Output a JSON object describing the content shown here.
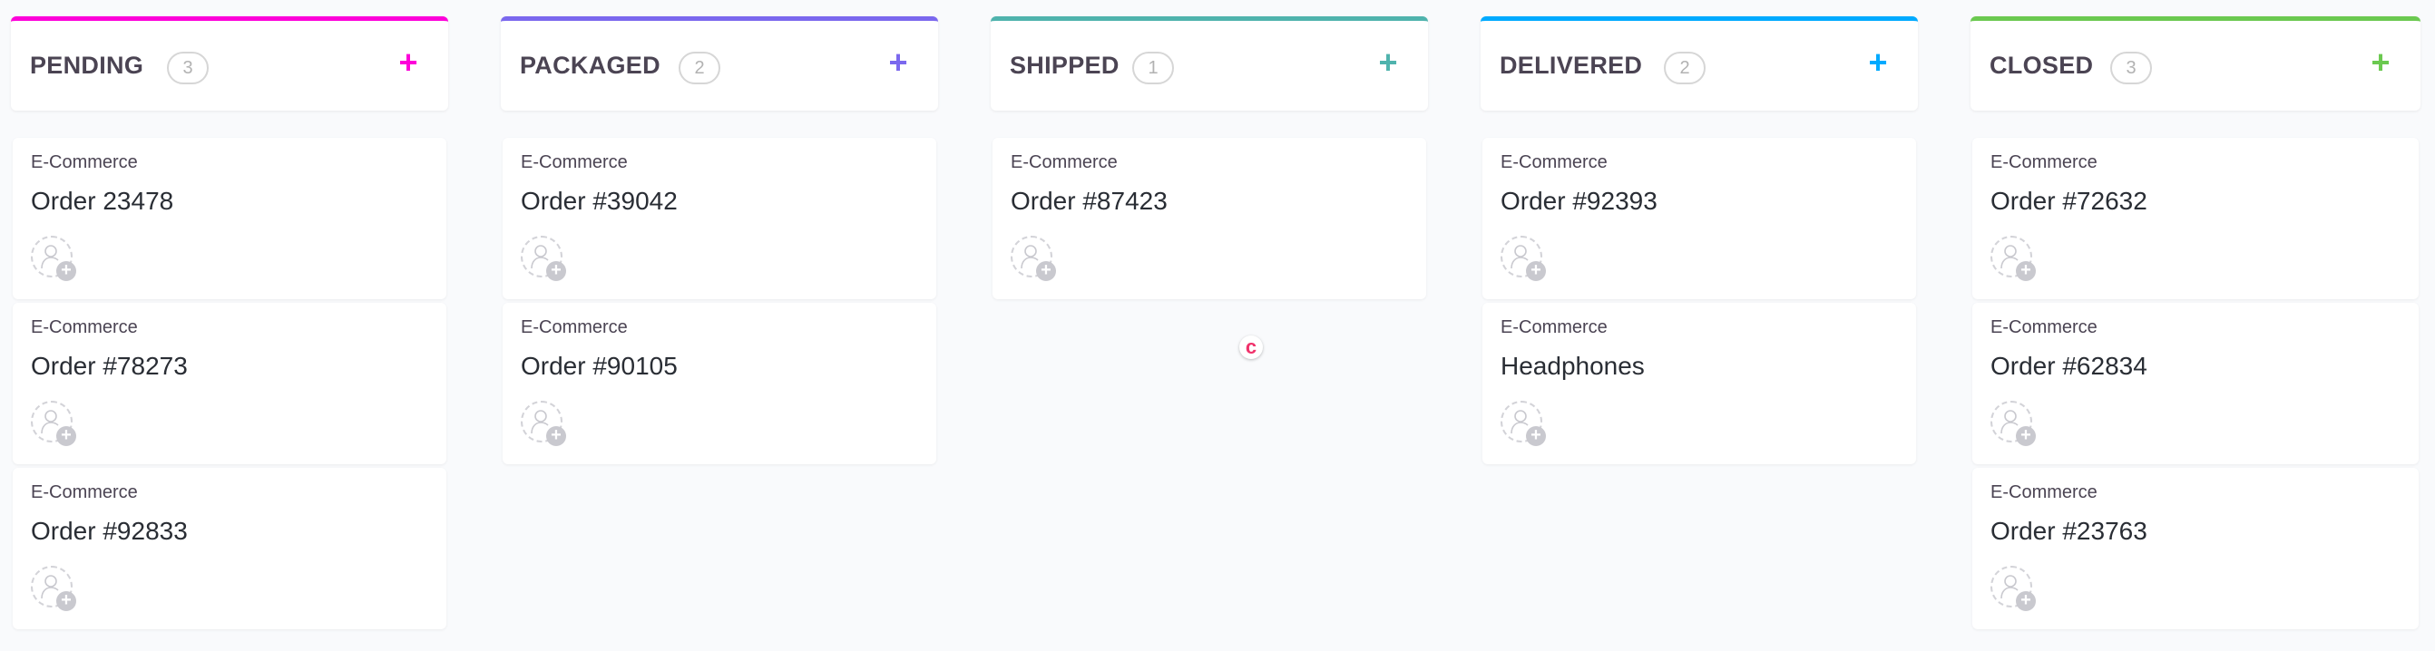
{
  "columns": [
    {
      "title": "PENDING",
      "count": "3",
      "accent": "#fd00d9",
      "cards": [
        {
          "category": "E-Commerce",
          "title": "Order 23478"
        },
        {
          "category": "E-Commerce",
          "title": "Order #78273"
        },
        {
          "category": "E-Commerce",
          "title": "Order #92833"
        }
      ]
    },
    {
      "title": "PACKAGED",
      "count": "2",
      "accent": "#7b68ee",
      "cards": [
        {
          "category": "E-Commerce",
          "title": "Order #39042"
        },
        {
          "category": "E-Commerce",
          "title": "Order #90105"
        }
      ]
    },
    {
      "title": "SHIPPED",
      "count": "1",
      "accent": "#4fb3ad",
      "cards": [
        {
          "category": "E-Commerce",
          "title": "Order #87423"
        }
      ]
    },
    {
      "title": "DELIVERED",
      "count": "2",
      "accent": "#00aaff",
      "cards": [
        {
          "category": "E-Commerce",
          "title": "Order #92393"
        },
        {
          "category": "E-Commerce",
          "title": "Headphones"
        }
      ]
    },
    {
      "title": "CLOSED",
      "count": "3",
      "accent": "#6bc950",
      "cards": [
        {
          "category": "E-Commerce",
          "title": "Order #72632"
        },
        {
          "category": "E-Commerce",
          "title": "Order #62834"
        },
        {
          "category": "E-Commerce",
          "title": "Order #23763"
        }
      ]
    }
  ],
  "icons": {
    "add": "+",
    "assignee_add": "+",
    "cursor_badge": "c"
  }
}
